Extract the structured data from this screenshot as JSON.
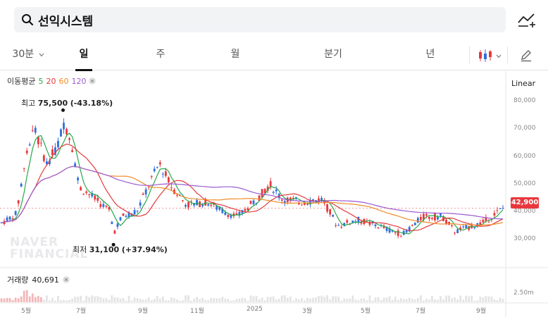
{
  "search": {
    "query": "선익시스템"
  },
  "tabs": [
    {
      "label": "30분",
      "active": false
    },
    {
      "label": "일",
      "active": true
    },
    {
      "label": "주",
      "active": false
    },
    {
      "label": "월",
      "active": false
    },
    {
      "label": "분기",
      "active": false
    },
    {
      "label": "년",
      "active": false
    }
  ],
  "icons": [
    "search-icon",
    "chart-toggle-icon",
    "chevron-down-icon",
    "candlestick-icon",
    "pencil-icon",
    "close-icon"
  ],
  "legend": {
    "label": "이동평균",
    "periods": [
      {
        "label": "5",
        "color": "#27a84a"
      },
      {
        "label": "20",
        "color": "#e33b3b"
      },
      {
        "label": "60",
        "color": "#f08c2a"
      },
      {
        "label": "120",
        "color": "#9b59d0"
      }
    ]
  },
  "scale": {
    "label": "Linear"
  },
  "price": {
    "current": "42,900",
    "color": "#e8383d"
  },
  "annotations": {
    "high": {
      "label": "최고",
      "value": "75,500",
      "change": "(-43.18%)"
    },
    "low": {
      "label": "최저",
      "value": "31,100",
      "change": "(+37.94%)"
    }
  },
  "volume": {
    "label": "거래량",
    "value": "40,691",
    "axis_label": "2.50m"
  },
  "watermark": {
    "line1": "NAVER",
    "line2": "FINANCIAL"
  },
  "chart_data": {
    "type": "candlestick",
    "up_color": "#e8383d",
    "down_color": "#2f6fde",
    "y_ticks": [
      "80,000",
      "70,000",
      "60,000",
      "50,000",
      "40,000",
      "30,000"
    ],
    "y_tick_values": [
      80000,
      70000,
      60000,
      50000,
      40000,
      30000
    ],
    "ylim": [
      25000,
      82000
    ],
    "x_ticks": [
      "5월",
      "7월",
      "9월",
      "11월",
      "2025",
      "3월",
      "5월",
      "7월",
      "9월"
    ],
    "close_path": [
      {
        "x": 0.0,
        "y": 38000
      },
      {
        "x": 0.03,
        "y": 41000
      },
      {
        "x": 0.05,
        "y": 62000
      },
      {
        "x": 0.065,
        "y": 70000
      },
      {
        "x": 0.09,
        "y": 58000
      },
      {
        "x": 0.11,
        "y": 63000
      },
      {
        "x": 0.125,
        "y": 72000
      },
      {
        "x": 0.14,
        "y": 65000
      },
      {
        "x": 0.155,
        "y": 50000
      },
      {
        "x": 0.18,
        "y": 47000
      },
      {
        "x": 0.215,
        "y": 42000
      },
      {
        "x": 0.225,
        "y": 35000
      },
      {
        "x": 0.24,
        "y": 40000
      },
      {
        "x": 0.27,
        "y": 42000
      },
      {
        "x": 0.3,
        "y": 53000
      },
      {
        "x": 0.315,
        "y": 58000
      },
      {
        "x": 0.34,
        "y": 50000
      },
      {
        "x": 0.37,
        "y": 44000
      },
      {
        "x": 0.41,
        "y": 45000
      },
      {
        "x": 0.44,
        "y": 42000
      },
      {
        "x": 0.47,
        "y": 40000
      },
      {
        "x": 0.51,
        "y": 46000
      },
      {
        "x": 0.535,
        "y": 51000
      },
      {
        "x": 0.56,
        "y": 46000
      },
      {
        "x": 0.6,
        "y": 45000
      },
      {
        "x": 0.64,
        "y": 46000
      },
      {
        "x": 0.67,
        "y": 37000
      },
      {
        "x": 0.71,
        "y": 39000
      },
      {
        "x": 0.75,
        "y": 37000
      },
      {
        "x": 0.8,
        "y": 34000
      },
      {
        "x": 0.84,
        "y": 40000
      },
      {
        "x": 0.88,
        "y": 40000
      },
      {
        "x": 0.905,
        "y": 35000
      },
      {
        "x": 0.94,
        "y": 37000
      },
      {
        "x": 0.96,
        "y": 38000
      },
      {
        "x": 1.0,
        "y": 42900
      }
    ],
    "ma": [
      {
        "name": "5",
        "color": "#27a84a",
        "smoothing": 3
      },
      {
        "name": "20",
        "color": "#e33b3b",
        "smoothing": 12
      },
      {
        "name": "60",
        "color": "#f08c2a",
        "smoothing": 38
      },
      {
        "name": "120",
        "color": "#9b59d0",
        "smoothing": 75
      }
    ],
    "high": 75500,
    "low": 31100
  }
}
